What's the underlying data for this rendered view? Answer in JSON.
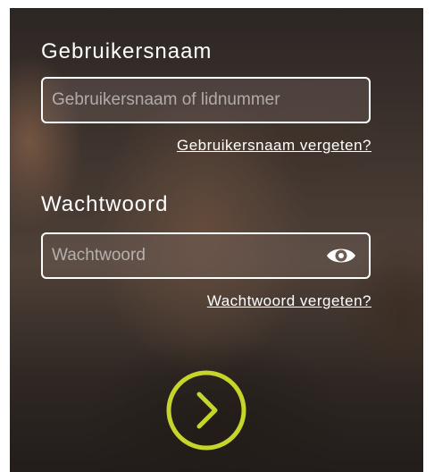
{
  "login": {
    "username_label": "Gebruikersnaam",
    "username_placeholder": "Gebruikersnaam of lidnummer",
    "forgot_username_link": "Gebruikersnaam vergeten?",
    "password_label": "Wachtwoord",
    "password_placeholder": "Wachtwoord",
    "forgot_password_link": "Wachtwoord vergeten?",
    "show_password_icon": "eye-icon",
    "submit_icon": "chevron-right-circle-icon"
  },
  "colors": {
    "text": "#ffffff",
    "accent": "#c5d52a",
    "field_border": "#ffffff"
  }
}
